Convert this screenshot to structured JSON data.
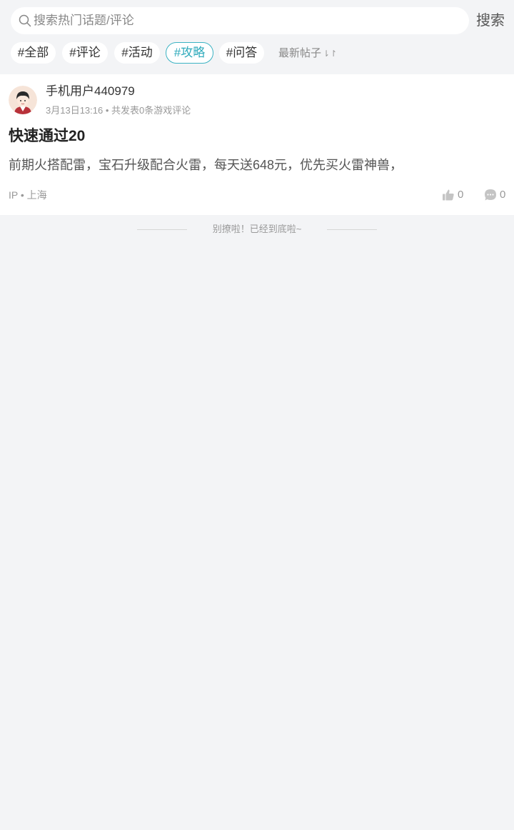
{
  "search": {
    "placeholder": "搜索热门话题/评论",
    "button_label": "搜索"
  },
  "tags": [
    {
      "label": "#全部",
      "active": false
    },
    {
      "label": "#评论",
      "active": false
    },
    {
      "label": "#活动",
      "active": false
    },
    {
      "label": "#攻略",
      "active": true
    },
    {
      "label": "#问答",
      "active": false
    }
  ],
  "sort": {
    "label": "最新帖子",
    "icon": "sort-arrows-icon"
  },
  "post": {
    "username": "手机用户440979",
    "date": "3月13日13:16",
    "stats": "共发表0条游戏评论",
    "title": "快速通过20",
    "content": "前期火搭配雷，宝石升级配合火雷，每天送648元，优先买火雷神兽，",
    "ip_label": "IP",
    "location": "上海",
    "likes": "0",
    "comments": "0"
  },
  "footer": {
    "text": "别撩啦！已经到底啦~"
  },
  "colors": {
    "accent": "#2eaabb",
    "background": "#f3f4f6",
    "card": "#ffffff"
  }
}
